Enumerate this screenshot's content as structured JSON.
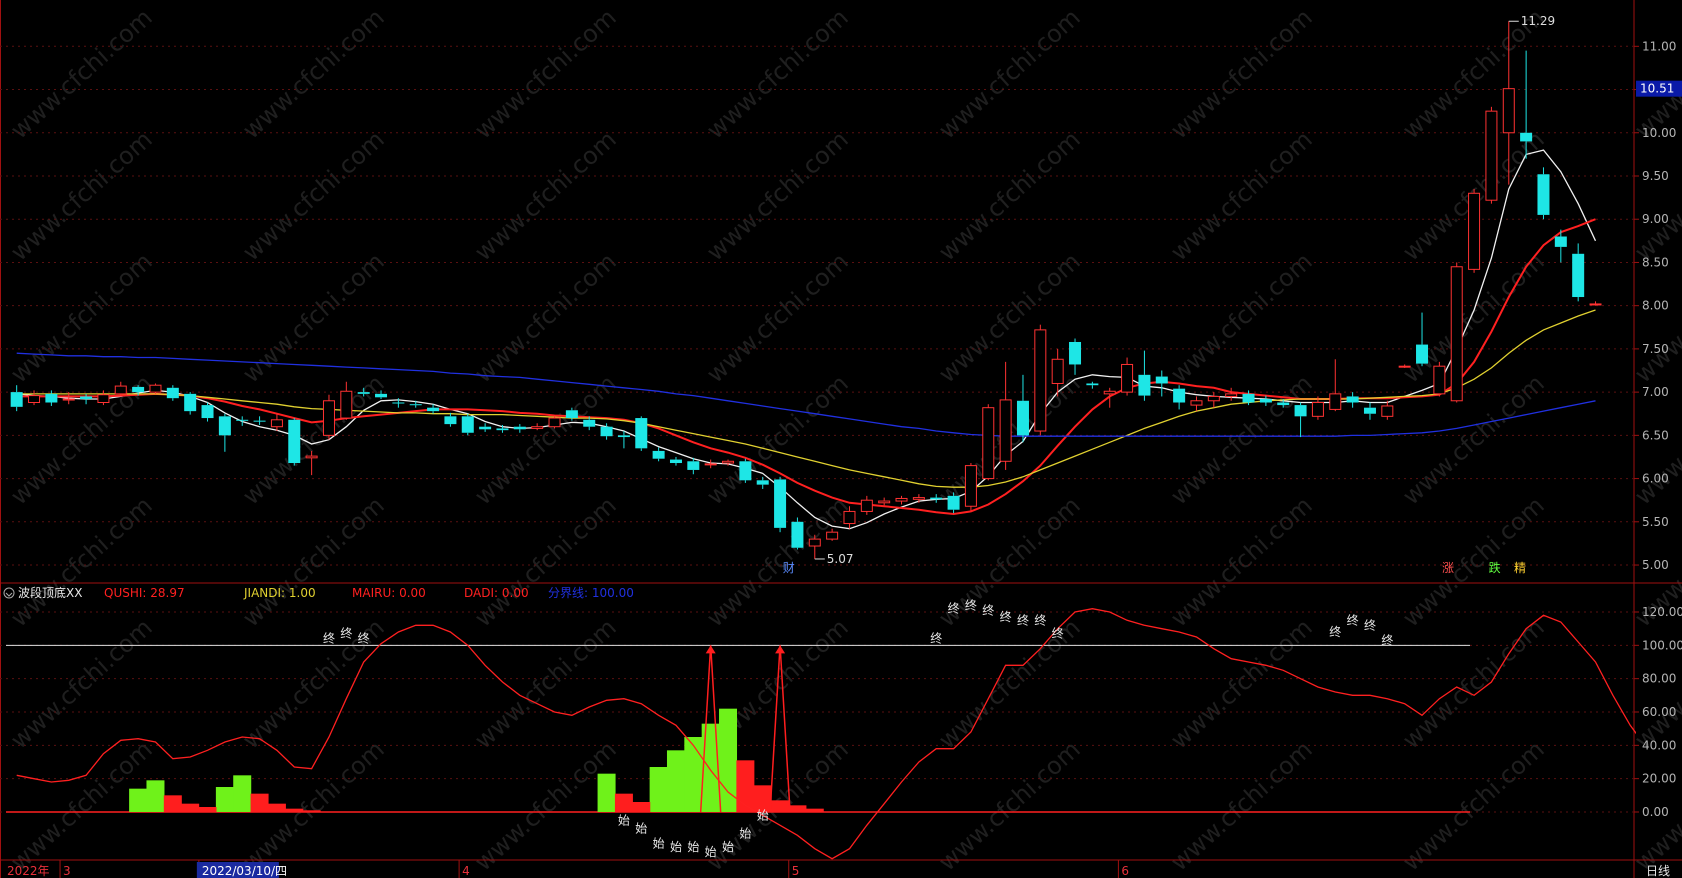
{
  "chart_data": [
    {
      "type": "candlestick",
      "panel": "price",
      "ylim": [
        4.85,
        11.42
      ],
      "yticks": [
        5.0,
        5.5,
        6.0,
        6.5,
        7.0,
        7.5,
        8.0,
        8.5,
        9.0,
        9.5,
        10.0,
        10.5,
        11.0
      ],
      "price_tag": "10.51",
      "max_label": "11.29",
      "min_label": "5.07",
      "marker_labels": [
        "财",
        "涨",
        "跌",
        "精"
      ],
      "candles": [
        [
          7.0,
          6.83,
          7.08,
          6.78
        ],
        [
          6.88,
          6.96,
          7.02,
          6.85
        ],
        [
          6.98,
          6.88,
          7.02,
          6.84
        ],
        [
          6.92,
          6.92,
          7.0,
          6.86
        ],
        [
          6.95,
          6.92,
          6.98,
          6.86
        ],
        [
          6.88,
          6.97,
          7.02,
          6.85
        ],
        [
          6.98,
          7.07,
          7.12,
          6.96
        ],
        [
          7.06,
          7.0,
          7.08,
          6.96
        ],
        [
          7.0,
          7.08,
          7.1,
          6.98
        ],
        [
          7.05,
          6.93,
          7.08,
          6.9
        ],
        [
          6.98,
          6.78,
          7.0,
          6.74
        ],
        [
          6.85,
          6.7,
          6.88,
          6.66
        ],
        [
          6.72,
          6.5,
          6.75,
          6.31
        ],
        [
          6.68,
          6.67,
          6.72,
          6.61
        ],
        [
          6.67,
          6.66,
          6.72,
          6.62
        ],
        [
          6.6,
          6.68,
          6.75,
          6.55
        ],
        [
          6.68,
          6.18,
          6.7,
          6.15
        ],
        [
          6.24,
          6.26,
          6.32,
          6.04
        ],
        [
          6.5,
          6.9,
          6.97,
          6.45
        ],
        [
          6.7,
          7.01,
          7.12,
          6.68
        ],
        [
          7.0,
          6.98,
          7.05,
          6.95
        ],
        [
          6.98,
          6.94,
          7.02,
          6.92
        ],
        [
          6.88,
          6.87,
          6.93,
          6.82
        ],
        [
          6.86,
          6.85,
          6.9,
          6.82
        ],
        [
          6.82,
          6.78,
          6.86,
          6.75
        ],
        [
          6.72,
          6.63,
          6.76,
          6.6
        ],
        [
          6.72,
          6.53,
          6.75,
          6.5
        ],
        [
          6.6,
          6.57,
          6.64,
          6.54
        ],
        [
          6.58,
          6.56,
          6.62,
          6.53
        ],
        [
          6.6,
          6.57,
          6.63,
          6.53
        ],
        [
          6.58,
          6.6,
          6.64,
          6.56
        ],
        [
          6.6,
          6.7,
          6.73,
          6.58
        ],
        [
          6.79,
          6.7,
          6.82,
          6.67
        ],
        [
          6.68,
          6.6,
          6.72,
          6.56
        ],
        [
          6.6,
          6.49,
          6.64,
          6.45
        ],
        [
          6.5,
          6.48,
          6.55,
          6.35
        ],
        [
          6.7,
          6.35,
          6.72,
          6.32
        ],
        [
          6.32,
          6.23,
          6.36,
          6.2
        ],
        [
          6.22,
          6.18,
          6.25,
          6.15
        ],
        [
          6.2,
          6.1,
          6.24,
          6.05
        ],
        [
          6.16,
          6.17,
          6.22,
          6.12
        ],
        [
          6.18,
          6.2,
          6.22,
          6.15
        ],
        [
          6.2,
          5.98,
          6.23,
          5.95
        ],
        [
          5.98,
          5.93,
          6.02,
          5.88
        ],
        [
          5.99,
          5.43,
          6.02,
          5.38
        ],
        [
          5.5,
          5.2,
          5.55,
          5.18
        ],
        [
          5.22,
          5.3,
          5.35,
          5.07
        ],
        [
          5.3,
          5.38,
          5.42,
          5.28
        ],
        [
          5.48,
          5.62,
          5.68,
          5.42
        ],
        [
          5.62,
          5.75,
          5.8,
          5.58
        ],
        [
          5.72,
          5.74,
          5.78,
          5.69
        ],
        [
          5.74,
          5.77,
          5.8,
          5.7
        ],
        [
          5.76,
          5.78,
          5.82,
          5.72
        ],
        [
          5.78,
          5.76,
          5.82,
          5.72
        ],
        [
          5.8,
          5.64,
          5.84,
          5.6
        ],
        [
          5.68,
          6.15,
          6.18,
          5.63
        ],
        [
          6.0,
          6.82,
          6.86,
          5.98
        ],
        [
          6.2,
          6.91,
          7.35,
          6.1
        ],
        [
          6.9,
          6.5,
          7.2,
          6.42
        ],
        [
          6.55,
          7.72,
          7.78,
          6.5
        ],
        [
          7.1,
          7.38,
          7.5,
          6.95
        ],
        [
          7.58,
          7.32,
          7.62,
          7.2
        ],
        [
          7.1,
          7.08,
          7.12,
          7.04
        ],
        [
          6.98,
          7.01,
          7.05,
          6.82
        ],
        [
          7.0,
          7.32,
          7.4,
          6.96
        ],
        [
          7.2,
          6.96,
          7.48,
          6.9
        ],
        [
          7.18,
          7.1,
          7.25,
          6.95
        ],
        [
          7.04,
          6.88,
          7.08,
          6.8
        ],
        [
          6.85,
          6.9,
          6.95,
          6.78
        ],
        [
          6.9,
          6.95,
          7.0,
          6.82
        ],
        [
          6.95,
          6.98,
          7.05,
          6.9
        ],
        [
          6.98,
          6.88,
          7.02,
          6.85
        ],
        [
          6.92,
          6.88,
          6.96,
          6.84
        ],
        [
          6.88,
          6.85,
          6.92,
          6.82
        ],
        [
          6.85,
          6.72,
          6.88,
          6.48
        ],
        [
          6.72,
          6.88,
          6.95,
          6.68
        ],
        [
          6.8,
          6.98,
          7.38,
          6.78
        ],
        [
          6.95,
          6.88,
          7.0,
          6.82
        ],
        [
          6.82,
          6.75,
          6.88,
          6.68
        ],
        [
          6.72,
          6.84,
          6.9,
          6.68
        ],
        [
          7.3,
          7.3,
          7.32,
          7.28
        ],
        [
          7.55,
          7.33,
          7.92,
          7.3
        ],
        [
          6.98,
          7.3,
          7.35,
          6.95
        ],
        [
          6.9,
          8.45,
          8.5,
          6.88
        ],
        [
          8.42,
          9.3,
          9.35,
          8.38
        ],
        [
          9.22,
          10.25,
          10.3,
          9.18
        ],
        [
          10.0,
          10.51,
          11.29,
          9.4
        ],
        [
          10.0,
          9.9,
          10.95,
          9.7
        ],
        [
          9.52,
          9.05,
          9.6,
          9.0
        ],
        [
          8.8,
          8.68,
          8.88,
          8.5
        ],
        [
          8.6,
          8.1,
          8.72,
          8.05
        ],
        [
          8.02,
          8.02,
          8.05,
          8.0
        ]
      ],
      "series": [
        {
          "name": "ma5",
          "color": "#f0f0f0",
          "start": 0,
          "values": [
            6.98,
            6.96,
            6.95,
            6.93,
            6.92,
            6.92,
            6.95,
            6.99,
            7.02,
            7.0,
            6.95,
            6.88,
            6.76,
            6.66,
            6.6,
            6.56,
            6.5,
            6.4,
            6.45,
            6.6,
            6.79,
            6.9,
            6.91,
            6.89,
            6.86,
            6.8,
            6.75,
            6.66,
            6.6,
            6.58,
            6.59,
            6.62,
            6.65,
            6.64,
            6.6,
            6.55,
            6.46,
            6.37,
            6.3,
            6.23,
            6.18,
            6.17,
            6.12,
            6.06,
            5.9,
            5.72,
            5.55,
            5.45,
            5.42,
            5.49,
            5.59,
            5.67,
            5.74,
            5.76,
            5.77,
            5.85,
            6.03,
            6.27,
            6.43,
            6.75,
            7.0,
            7.15,
            7.2,
            7.18,
            7.17,
            7.07,
            7.05,
            7.0,
            6.97,
            6.95,
            6.94,
            6.93,
            6.92,
            6.9,
            6.88,
            6.88,
            6.88,
            6.9,
            6.88,
            6.88,
            6.95,
            7.02,
            7.1,
            7.5,
            7.95,
            8.55,
            9.35,
            9.75,
            9.8,
            9.55,
            9.18,
            8.75
          ]
        },
        {
          "name": "ma10",
          "color": "#ff2020",
          "start": 0,
          "values": [
            6.95,
            6.95,
            6.95,
            6.95,
            6.95,
            6.95,
            6.96,
            6.97,
            6.98,
            6.97,
            6.96,
            6.93,
            6.89,
            6.84,
            6.8,
            6.75,
            6.7,
            6.65,
            6.67,
            6.7,
            6.72,
            6.74,
            6.76,
            6.78,
            6.8,
            6.8,
            6.8,
            6.79,
            6.78,
            6.76,
            6.75,
            6.73,
            6.72,
            6.71,
            6.7,
            6.68,
            6.64,
            6.58,
            6.5,
            6.42,
            6.35,
            6.3,
            6.24,
            6.16,
            6.06,
            5.95,
            5.86,
            5.78,
            5.72,
            5.7,
            5.68,
            5.66,
            5.64,
            5.61,
            5.59,
            5.62,
            5.7,
            5.82,
            5.97,
            6.15,
            6.38,
            6.6,
            6.8,
            6.95,
            7.05,
            7.1,
            7.12,
            7.1,
            7.07,
            7.05,
            7.0,
            6.98,
            6.96,
            6.94,
            6.92,
            6.92,
            6.92,
            6.93,
            6.93,
            6.93,
            6.94,
            6.95,
            6.97,
            7.1,
            7.35,
            7.7,
            8.1,
            8.45,
            8.7,
            8.85,
            8.92,
            9.0
          ]
        },
        {
          "name": "ma20",
          "color": "#e0d030",
          "start": 0,
          "values": [
            6.98,
            6.98,
            6.98,
            6.98,
            6.98,
            6.98,
            6.98,
            6.98,
            6.98,
            6.97,
            6.96,
            6.94,
            6.92,
            6.9,
            6.88,
            6.86,
            6.83,
            6.81,
            6.8,
            6.79,
            6.78,
            6.77,
            6.76,
            6.76,
            6.75,
            6.75,
            6.74,
            6.74,
            6.74,
            6.73,
            6.72,
            6.71,
            6.7,
            6.7,
            6.69,
            6.67,
            6.64,
            6.6,
            6.56,
            6.52,
            6.48,
            6.44,
            6.4,
            6.35,
            6.3,
            6.25,
            6.2,
            6.15,
            6.1,
            6.06,
            6.02,
            5.98,
            5.94,
            5.91,
            5.9,
            5.9,
            5.92,
            5.96,
            6.02,
            6.1,
            6.18,
            6.26,
            6.34,
            6.42,
            6.5,
            6.58,
            6.65,
            6.72,
            6.78,
            6.82,
            6.86,
            6.88,
            6.9,
            6.91,
            6.92,
            6.92,
            6.92,
            6.92,
            6.93,
            6.94,
            6.95,
            6.96,
            6.98,
            7.05,
            7.15,
            7.28,
            7.45,
            7.6,
            7.72,
            7.8,
            7.88,
            7.95
          ]
        },
        {
          "name": "ma60",
          "color": "#2030e0",
          "start": 0,
          "values": [
            7.45,
            7.44,
            7.43,
            7.42,
            7.42,
            7.41,
            7.41,
            7.4,
            7.4,
            7.39,
            7.38,
            7.37,
            7.36,
            7.35,
            7.34,
            7.33,
            7.32,
            7.31,
            7.3,
            7.29,
            7.28,
            7.27,
            7.26,
            7.25,
            7.24,
            7.22,
            7.21,
            7.19,
            7.18,
            7.17,
            7.15,
            7.13,
            7.11,
            7.09,
            7.07,
            7.05,
            7.03,
            7.01,
            6.98,
            6.96,
            6.93,
            6.9,
            6.87,
            6.84,
            6.81,
            6.78,
            6.75,
            6.72,
            6.69,
            6.66,
            6.63,
            6.6,
            6.58,
            6.55,
            6.53,
            6.51,
            6.5,
            6.49,
            6.49,
            6.49,
            6.49,
            6.49,
            6.49,
            6.49,
            6.49,
            6.49,
            6.49,
            6.49,
            6.49,
            6.49,
            6.49,
            6.49,
            6.49,
            6.49,
            6.49,
            6.49,
            6.49,
            6.5,
            6.5,
            6.51,
            6.52,
            6.53,
            6.55,
            6.58,
            6.62,
            6.66,
            6.7,
            6.74,
            6.78,
            6.82,
            6.86,
            6.9
          ]
        }
      ]
    },
    {
      "type": "indicator",
      "panel": "oscillator",
      "title": "波段顶底XX",
      "legend": [
        {
          "text": "QUSHI: 28.97",
          "color": "#ff2020"
        },
        {
          "text": "JIANDI: 1.00",
          "color": "#e0d030"
        },
        {
          "text": "MAIRU: 0.00",
          "color": "#ff2020"
        },
        {
          "text": "DADI: 0.00",
          "color": "#ff2020"
        },
        {
          "text": "分界线: 100.00",
          "color": "#2030e0"
        }
      ],
      "ylim": [
        -30,
        132
      ],
      "yticks": [
        0.0,
        20.0,
        40.0,
        60.0,
        80.0,
        100.0,
        120.0
      ],
      "ytick_labels": [
        "0.00",
        "20.00",
        "40.00",
        "60.00",
        "80.00",
        "100.00",
        "120.00"
      ],
      "boundary": 100,
      "qushi": [
        22,
        20,
        18,
        19,
        22,
        35,
        43,
        44,
        42,
        32,
        33,
        37,
        42,
        45,
        44,
        37,
        27,
        26,
        45,
        68,
        90,
        101,
        108,
        112,
        112,
        108,
        100,
        88,
        78,
        70,
        65,
        60,
        58,
        63,
        67,
        68,
        65,
        58,
        52,
        40,
        25,
        12,
        4,
        -2,
        -8,
        -14,
        -22,
        -28,
        -22,
        -8,
        5,
        18,
        30,
        38,
        38,
        48,
        68,
        88,
        88,
        98,
        110,
        120,
        122,
        120,
        115,
        112,
        110,
        108,
        105,
        98,
        92,
        90,
        88,
        85,
        80,
        75,
        72,
        70,
        70,
        68,
        65,
        58,
        68,
        75,
        70,
        78,
        95,
        110,
        118,
        114,
        102,
        90,
        70,
        52,
        38,
        29
      ],
      "green_bars": {
        "7": 14,
        "8": 19,
        "12": 15,
        "13": 22,
        "34": 23,
        "37": 27,
        "38": 37,
        "39": 45,
        "40": 53,
        "41": 62
      },
      "red_bars": {
        "9": 10,
        "10": 5,
        "11": 3,
        "14": 11,
        "15": 5,
        "16": 2,
        "17": 1,
        "35": 11,
        "36": 6,
        "42": 31,
        "43": 16,
        "44": 7,
        "45": 4,
        "46": 2
      },
      "spikes": [
        40,
        44
      ],
      "zhong_marks": [
        [
          18,
          104
        ],
        [
          19,
          107
        ],
        [
          20,
          104
        ],
        [
          53,
          104
        ],
        [
          54,
          122
        ],
        [
          55,
          124
        ],
        [
          56,
          121
        ],
        [
          57,
          117
        ],
        [
          58,
          115
        ],
        [
          59,
          115
        ],
        [
          60,
          107
        ],
        [
          76,
          108
        ],
        [
          77,
          115
        ],
        [
          78,
          112
        ],
        [
          79,
          103
        ]
      ],
      "shi_marks": [
        [
          35,
          -5
        ],
        [
          36,
          -10
        ],
        [
          37,
          -19
        ],
        [
          38,
          -21
        ],
        [
          39,
          -21
        ],
        [
          40,
          -24
        ],
        [
          41,
          -21
        ],
        [
          42,
          -13
        ],
        [
          43,
          -2
        ]
      ],
      "zhong_text": "终",
      "shi_text": "始"
    }
  ],
  "time_axis": {
    "labels": [
      {
        "text": "2022年",
        "idx": 0
      },
      {
        "text": "3",
        "idx": 3
      },
      {
        "text": "2022/03/10/四",
        "idx": 11
      },
      {
        "text": "4",
        "idx": 26
      },
      {
        "text": "5",
        "idx": 45
      },
      {
        "text": "6",
        "idx": 64
      }
    ],
    "period": "日线"
  },
  "watermark": "www.cfchi.com"
}
